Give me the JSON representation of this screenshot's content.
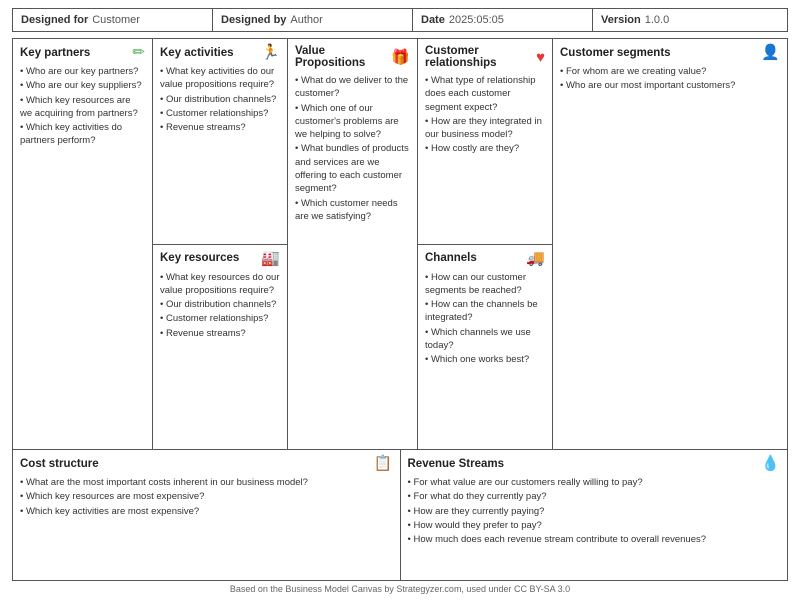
{
  "header": {
    "designed_for_label": "Designed for",
    "designed_for_value": "Customer",
    "designed_by_label": "Designed by",
    "designed_by_value": "Author",
    "date_label": "Date",
    "date_value": "2025:05:05",
    "version_label": "Version",
    "version_value": "1.0.0"
  },
  "sections": {
    "key_partners": {
      "title": "Key partners",
      "icon": "✏",
      "items": [
        "Who are our key partners?",
        "Who are our key suppliers?",
        "Which key resources are we acquiring from partners?",
        "Which key activities do partners perform?"
      ]
    },
    "key_activities": {
      "title": "Key activities",
      "icon": "🏃",
      "items": [
        "What key activities do our value propositions require?",
        "Our distribution channels?",
        "Customer relationships?",
        "Revenue streams?"
      ]
    },
    "key_resources": {
      "title": "Key resources",
      "icon": "🏭",
      "items": [
        "What key resources do our value propositions require?",
        "Our distribution channels?",
        "Customer relationships?",
        "Revenue streams?"
      ]
    },
    "value_propositions": {
      "title": "Value Propositions",
      "icon": "🎁",
      "items": [
        "What do we deliver to the customer?",
        "Which one of our customer's problems are we helping to solve?",
        "What bundles of products and services are we offering to each customer segment?",
        "Which customer needs are we satisfying?"
      ]
    },
    "customer_relationships": {
      "title": "Customer relationships",
      "icon": "♥",
      "items": [
        "What type of relationship does each customer segment expect?",
        "How are they integrated in our business model?",
        "How costly are they?"
      ]
    },
    "channels": {
      "title": "Channels",
      "icon": "🚚",
      "items": [
        "How can our customer segments be reached?",
        "How can the channels be integrated?",
        "Which channels we use today?",
        "Which one works best?"
      ]
    },
    "customer_segments": {
      "title": "Customer segments",
      "icon": "👤",
      "items": [
        "For whom are we creating value?",
        "Who are our most important customers?"
      ]
    },
    "cost_structure": {
      "title": "Cost structure",
      "icon": "📋",
      "items": [
        "What are the most important costs inherent in our business model?",
        "Which key resources are most expensive?",
        "Which key activities are most expensive?"
      ]
    },
    "revenue_streams": {
      "title": "Revenue Streams",
      "icon": "💧",
      "items": [
        "For what value are our customers really willing to pay?",
        "For what do they currently pay?",
        "How are they currently paying?",
        "How would they prefer to pay?",
        "How much does each revenue stream contribute to overall revenues?"
      ]
    }
  },
  "footer": {
    "text": "Based on the Business Model Canvas by Strategyzer.com, used under CC BY-SA 3.0"
  }
}
